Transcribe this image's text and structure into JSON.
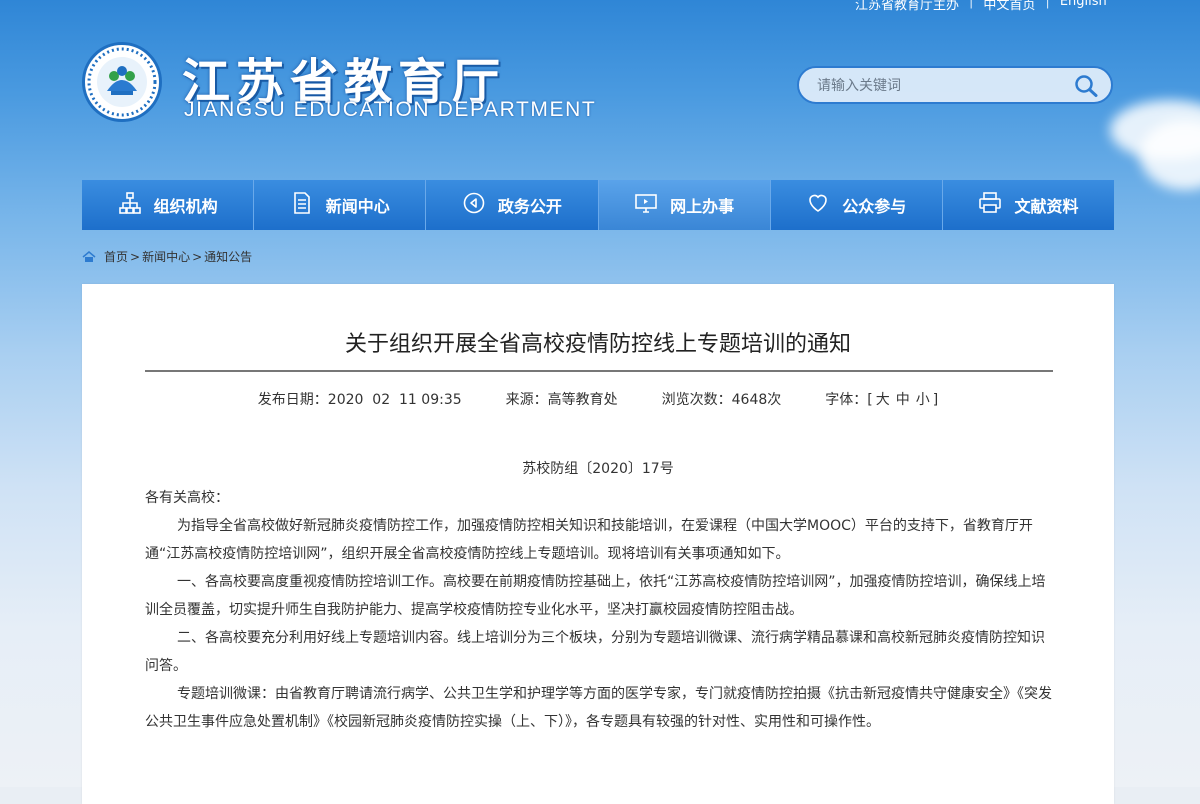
{
  "top_links": {
    "site": "江苏省教育厅主办",
    "chinese": "中文首页",
    "english": "English"
  },
  "header": {
    "title": "江苏省教育厅",
    "subtitle": "JIANGSU EDUCATION DEPARTMENT"
  },
  "search": {
    "placeholder": "请输入关键词",
    "icon": "search-icon"
  },
  "nav": {
    "items": [
      {
        "label": "组织机构",
        "icon": "org-chart-icon"
      },
      {
        "label": "新闻中心",
        "icon": "document-icon"
      },
      {
        "label": "政务公开",
        "icon": "play-circle-icon"
      },
      {
        "label": "网上办事",
        "icon": "monitor-icon"
      },
      {
        "label": "公众参与",
        "icon": "heart-icon"
      },
      {
        "label": "文献资料",
        "icon": "printer-icon"
      }
    ],
    "active_index": 3
  },
  "breadcrumb": {
    "home": "首页",
    "sep1": ">",
    "news": "新闻中心",
    "sep2": ">",
    "current": "通知公告"
  },
  "article": {
    "title": "关于组织开展全省高校疫情防控线上专题培训的通知",
    "meta": {
      "date": "发布日期：2020  02  11 09:35",
      "source": "来源：高等教育处",
      "views": "浏览次数：4648次",
      "font_label": "字体：[",
      "font_large": "大",
      "font_medium": "中",
      "font_small": "小",
      "font_close": "]"
    },
    "doc_number": "苏校防组〔2020〕17号",
    "salutation": "各有关高校：",
    "paragraphs": [
      "为指导全省高校做好新冠肺炎疫情防控工作，加强疫情防控相关知识和技能培训，在爱课程（中国大学MOOC）平台的支持下，省教育厅开通“江苏高校疫情防控培训网”，组织开展全省高校疫情防控线上专题培训。现将培训有关事项通知如下。",
      "一、各高校要高度重视疫情防控培训工作。高校要在前期疫情防控基础上，依托“江苏高校疫情防控培训网”，加强疫情防控培训，确保线上培训全员覆盖，切实提升师生自我防护能力、提高学校疫情防控专业化水平，坚决打赢校园疫情防控阻击战。",
      "二、各高校要充分利用好线上专题培训内容。线上培训分为三个板块，分别为专题培训微课、流行病学精品慕课和高校新冠肺炎疫情防控知识问答。",
      "专题培训微课：由省教育厅聘请流行病学、公共卫生学和护理学等方面的医学专家，专门就疫情防控拍摄《抗击新冠疫情共守健康安全》《突发公共卫生事件应急处置机制》《校园新冠肺炎疫情防控实操（上、下）》，各专题具有较强的针对性、实用性和可操作性。"
    ]
  },
  "colors": {
    "nav_blue": "#1d6fcb",
    "nav_active": "#3a86d6",
    "sky_top": "#2f86d6"
  }
}
